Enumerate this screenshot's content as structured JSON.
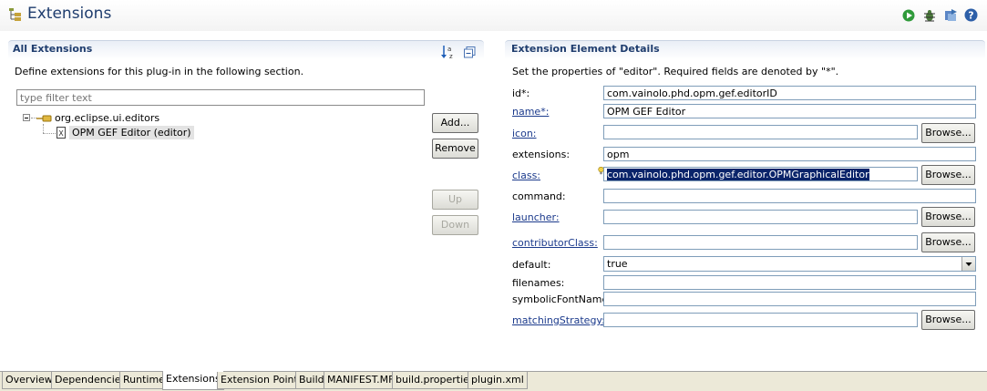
{
  "header": {
    "title": "Extensions"
  },
  "all_extensions": {
    "title": "All Extensions",
    "description": "Define extensions for this plug-in in the following section.",
    "filter_placeholder": "type filter text",
    "tree": {
      "root_label": "org.eclipse.ui.editors",
      "child_label": "OPM GEF Editor (editor)"
    },
    "buttons": {
      "add": "Add...",
      "remove": "Remove",
      "up": "Up",
      "down": "Down"
    }
  },
  "details": {
    "title": "Extension Element Details",
    "description": "Set the properties of \"editor\". Required fields are denoted by \"*\".",
    "browse_label": "Browse...",
    "fields": {
      "id": {
        "label": "id*:",
        "value": "com.vainolo.phd.opm.gef.editorID"
      },
      "name": {
        "label": "name*:",
        "value": "OPM GEF Editor"
      },
      "icon": {
        "label": "icon:",
        "value": ""
      },
      "extensions": {
        "label": "extensions:",
        "value": "opm"
      },
      "class": {
        "label": "class:",
        "value": "com.vainolo.phd.opm.gef.editor.OPMGraphicalEditor"
      },
      "command": {
        "label": "command:",
        "value": ""
      },
      "launcher": {
        "label": "launcher:",
        "value": ""
      },
      "contributorClass": {
        "label": "contributorClass:",
        "value": ""
      },
      "default": {
        "label": "default:",
        "value": "true"
      },
      "filenames": {
        "label": "filenames:",
        "value": ""
      },
      "symbolicFontName": {
        "label": "symbolicFontName:",
        "value": ""
      },
      "matchingStrategy": {
        "label": "matchingStrategy:",
        "value": ""
      }
    }
  },
  "tabs": [
    "Overview",
    "Dependencies",
    "Runtime",
    "Extensions",
    "Extension Points",
    "Build",
    "MANIFEST.MF",
    "build.properties",
    "plugin.xml"
  ],
  "active_tab": "Extensions",
  "icons": {
    "title": "extensions-icon",
    "run": "run-icon",
    "debug": "debug-icon",
    "export": "export-icon",
    "help": "help-icon",
    "sort": "sort-alpha-icon",
    "collapse": "collapse-all-icon"
  },
  "colors": {
    "title_text": "#1f3d6e",
    "link": "#1b3a8c",
    "selection": "#0a246a"
  }
}
